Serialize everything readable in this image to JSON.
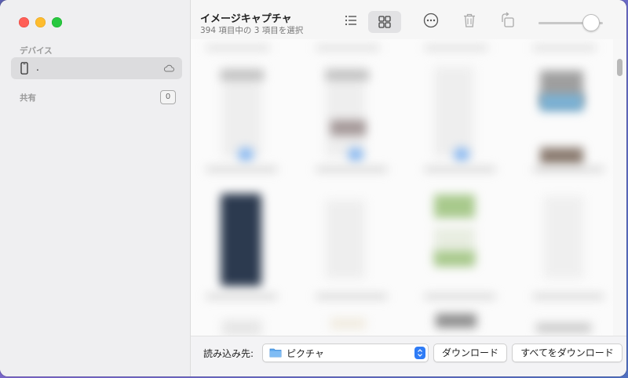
{
  "window": {
    "title": "イメージキャプチャ",
    "subtitle": "394 項目中の 3 項目を選択"
  },
  "sidebar": {
    "devices_label": "デバイス",
    "device_name": ".",
    "shared_label": "共有",
    "shared_count": "0"
  },
  "toolbar": {
    "list_view_icon": "list-view-icon",
    "grid_view_icon": "grid-view-icon",
    "more_icon": "ellipsis-circle-icon",
    "delete_icon": "trash-icon",
    "rotate_icon": "rotate-icon",
    "thumbnail_size": 0.8
  },
  "footer": {
    "import_label": "読み込み先:",
    "destination": "ピクチャ",
    "download_label": "ダウンロード",
    "download_all_label": "すべてをダウンロード"
  },
  "colors": {
    "accent": "#2f7cf6",
    "close": "#ff5f57",
    "minimize": "#febc2e",
    "zoom": "#28c840"
  }
}
